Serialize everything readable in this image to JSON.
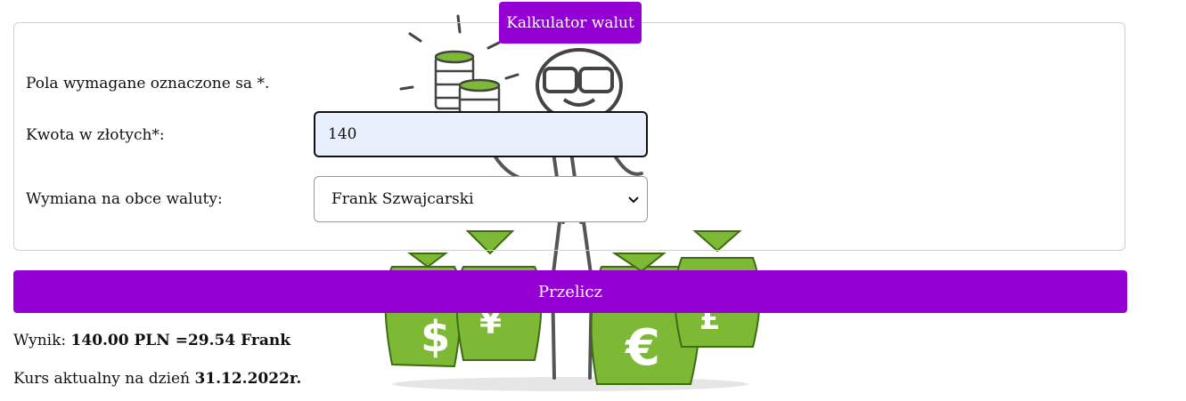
{
  "form": {
    "legend": "Kalkulator walut",
    "required_note": "Pola wymagane oznaczone sa *.",
    "amount_label": "Kwota w złotych*:",
    "amount_value": "140",
    "currency_label": "Wymiana na obce waluty:",
    "currency_selected": "Frank Szwajcarski",
    "submit_label": "Przelicz"
  },
  "result": {
    "prefix": "Wynik: ",
    "value": "140.00 PLN =29.54 Frank"
  },
  "rate": {
    "prefix": "Kurs aktualny na dzień ",
    "date": "31.12.2022r."
  },
  "icons": {
    "background": "money-bags-illustration",
    "select_arrow": "chevron-down-icon"
  },
  "colors": {
    "accent": "#9400d3",
    "input_bg": "#e8f0fe",
    "illustration_green": "#7db935"
  }
}
